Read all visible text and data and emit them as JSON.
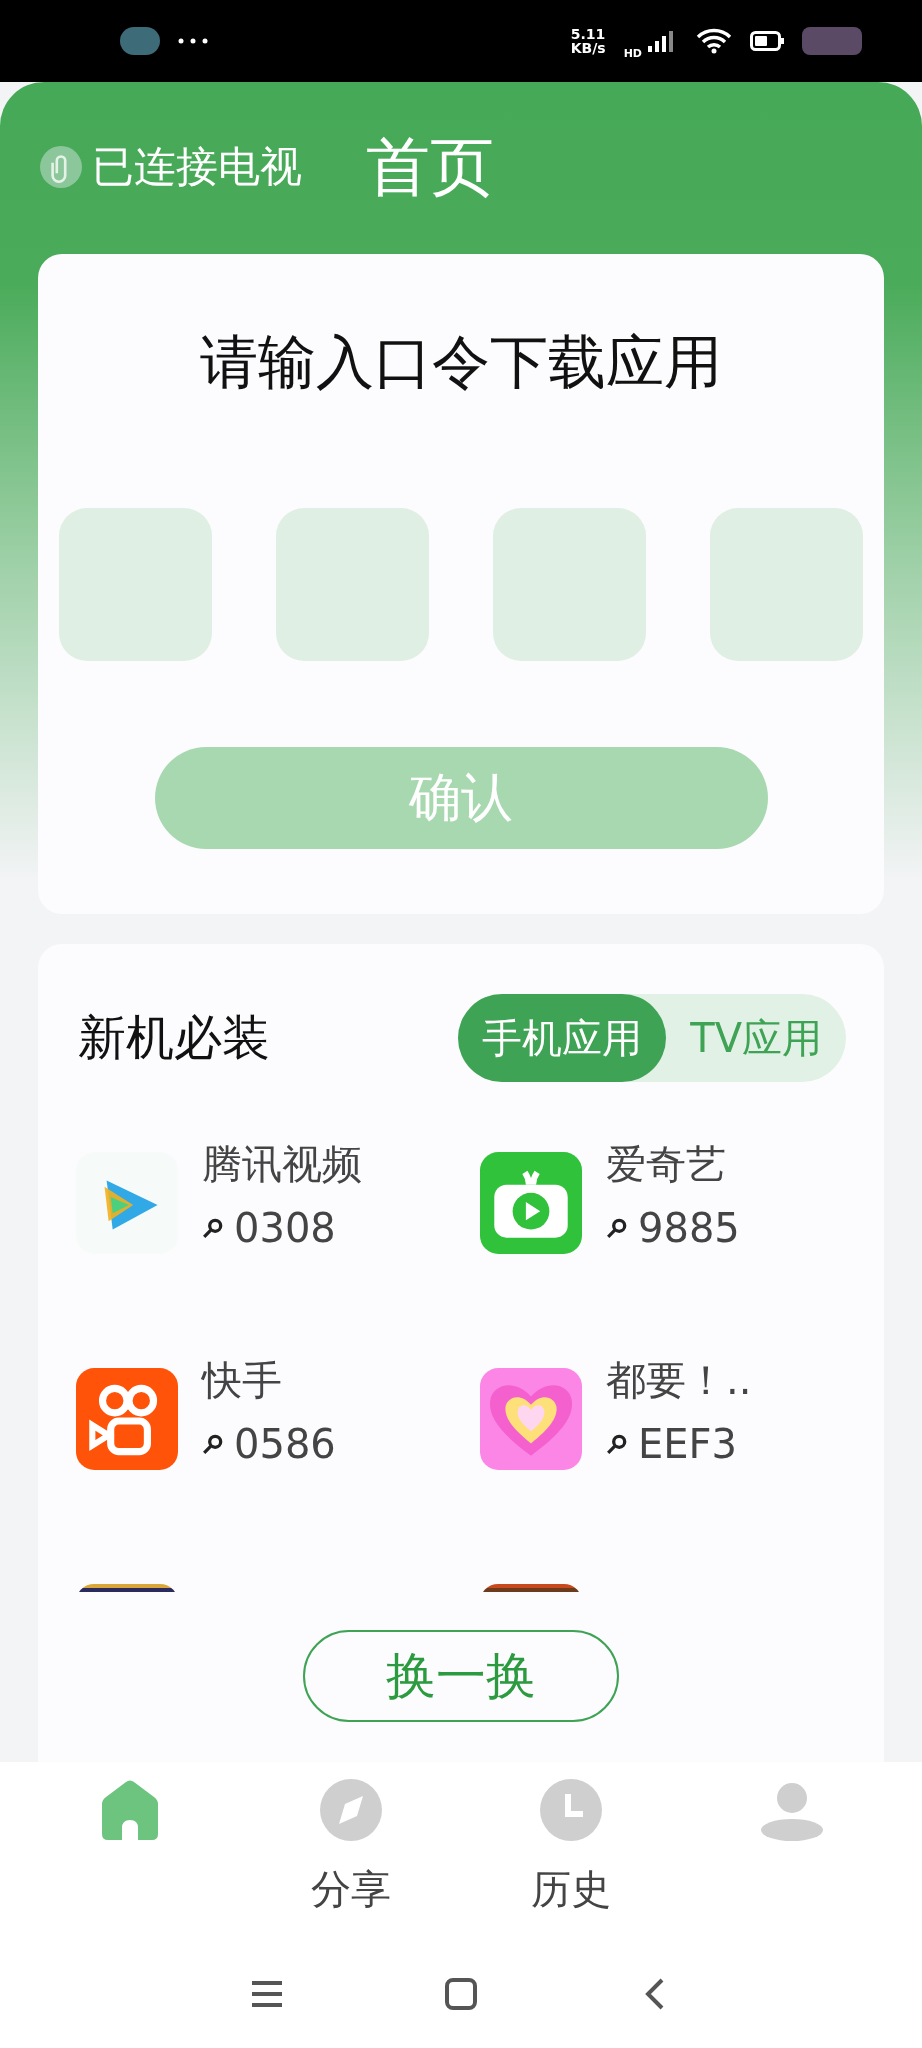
{
  "status_bar": {
    "speed_value": "5.11",
    "speed_unit": "KB/s",
    "network": "HD"
  },
  "header": {
    "connection": "已连接电视",
    "title": "首页"
  },
  "code_card": {
    "title": "请输入口令下载应用",
    "code_boxes": [
      {
        "filled": false
      },
      {
        "filled": false
      },
      {
        "filled": false
      },
      {
        "filled": false
      }
    ],
    "confirm": {
      "label": "确认",
      "disabled": true
    }
  },
  "apps_card": {
    "title": "新机必装",
    "tabs": [
      {
        "label": "手机应用",
        "selected": true
      },
      {
        "label": "TV应用",
        "selected": false
      }
    ],
    "apps": [
      {
        "name": "腾讯视频",
        "code": "0308",
        "kind": "play"
      },
      {
        "name": "爱奇艺",
        "code": "9885",
        "kind": "fruit-tv"
      },
      {
        "name": "快手",
        "code": "0586",
        "kind": "camera"
      },
      {
        "name": "都要！..",
        "code": "EEF3",
        "kind": "heart"
      },
      {
        "kind": "cut-dark"
      },
      {
        "kind": "cut-red"
      }
    ],
    "refresh": "换一换"
  },
  "bottom_nav": [
    {
      "kind": "home",
      "selected": true
    },
    {
      "kind": "compass",
      "label": "分享",
      "selected": false
    },
    {
      "kind": "clock",
      "label": "历史",
      "selected": false
    },
    {
      "kind": "person",
      "selected": false
    }
  ]
}
